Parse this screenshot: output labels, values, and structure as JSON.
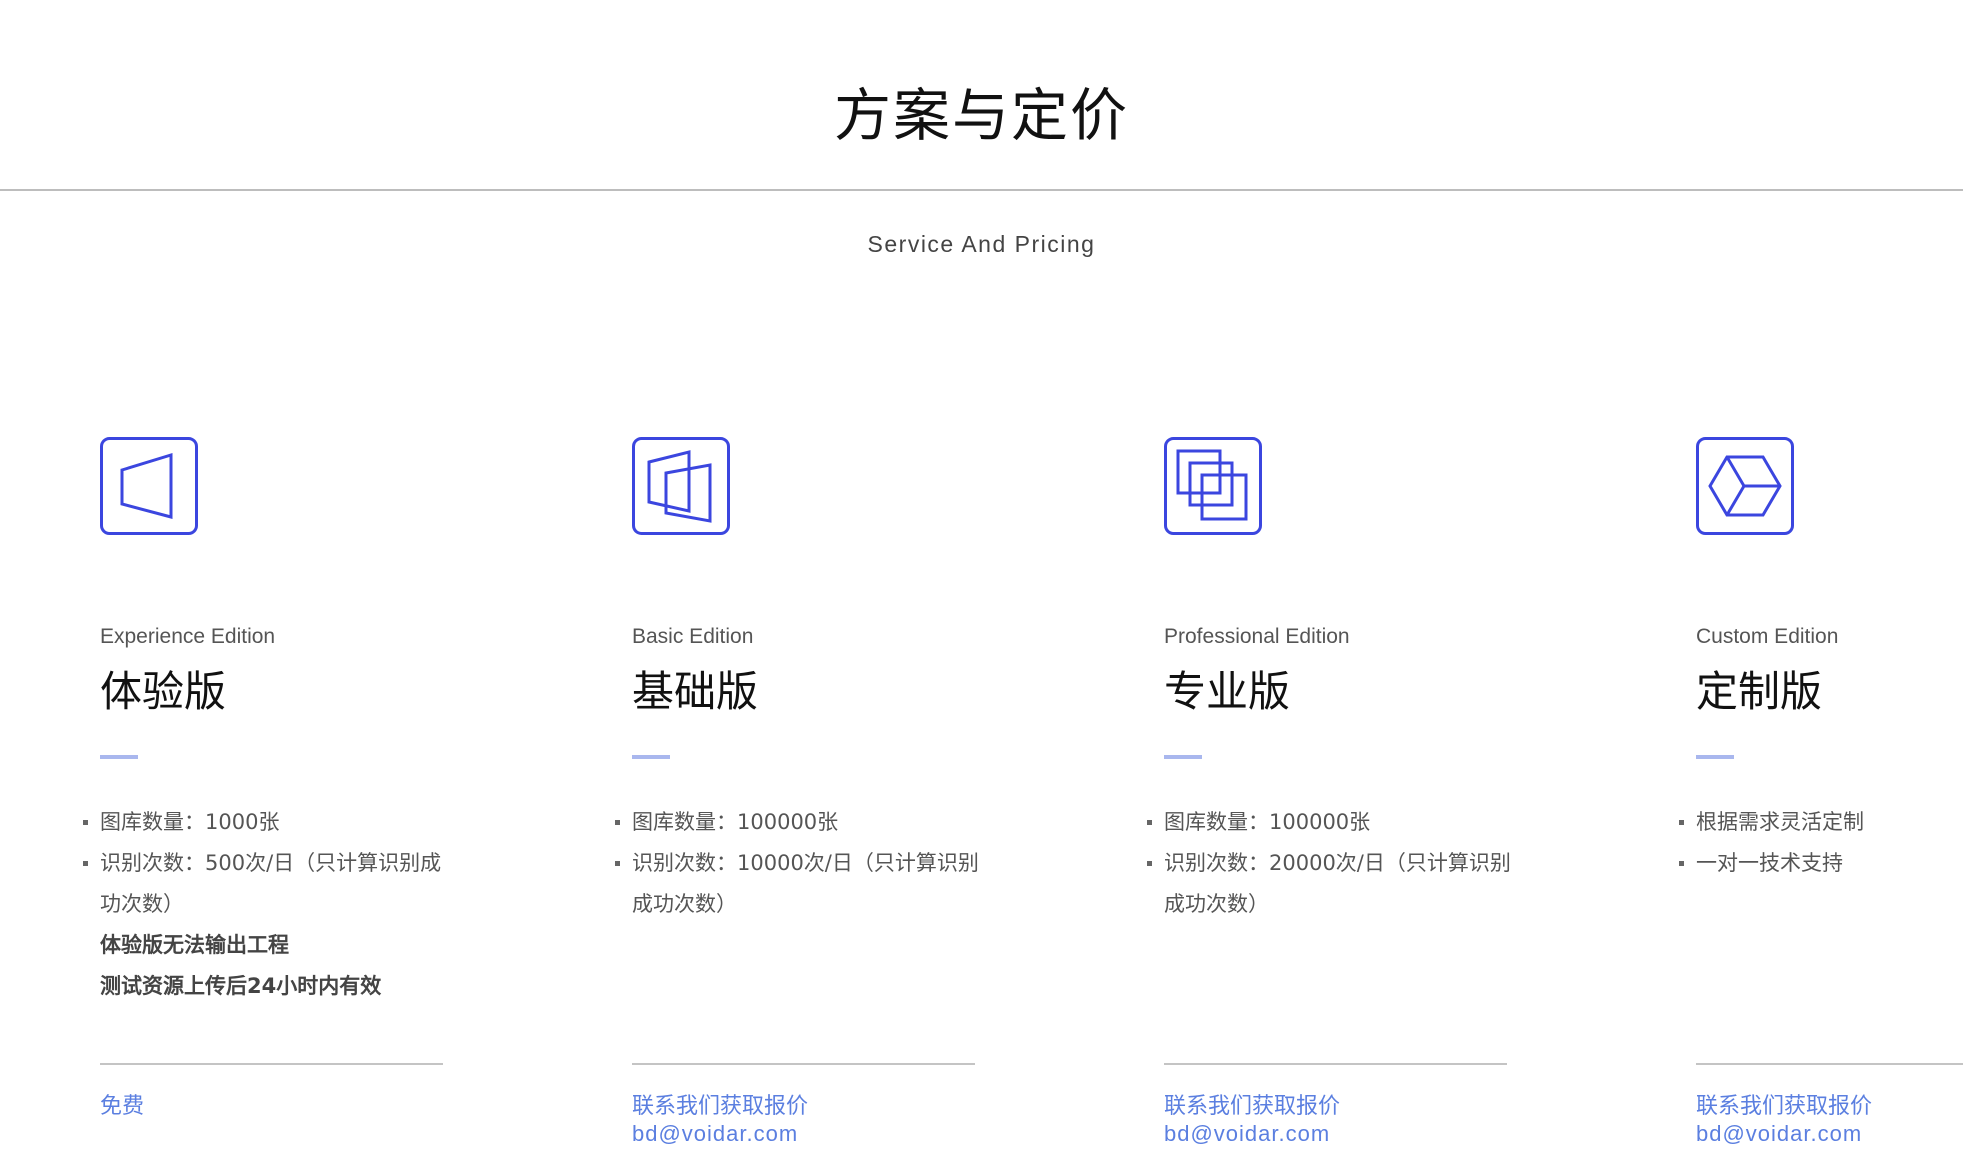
{
  "header": {
    "title": "方案与定价",
    "subtitle": "Service And Pricing"
  },
  "colors": {
    "accent": "#3b46df",
    "link": "#5b7fe0",
    "dash": "#a9b7ee"
  },
  "plans": [
    {
      "icon": "single-panel-icon",
      "edition_en": "Experience Edition",
      "edition_cn": "体验版",
      "features": [
        "图库数量：1000张",
        "识别次数：500次/日（只计算识别成功次数）"
      ],
      "notes": [
        "体验版无法输出工程",
        "测试资源上传后24小时内有效"
      ],
      "price": "免费",
      "email": ""
    },
    {
      "icon": "double-panel-icon",
      "edition_en": "Basic Edition",
      "edition_cn": "基础版",
      "features": [
        "图库数量：100000张",
        "识别次数：10000次/日（只计算识别成功次数）"
      ],
      "notes": [],
      "price": "联系我们获取报价",
      "email": "bd@voidar.com"
    },
    {
      "icon": "stacked-squares-icon",
      "edition_en": "Professional Edition",
      "edition_cn": "专业版",
      "features": [
        "图库数量：100000张",
        "识别次数：20000次/日（只计算识别成功次数）"
      ],
      "notes": [],
      "price": "联系我们获取报价",
      "email": "bd@voidar.com"
    },
    {
      "icon": "cube-icon",
      "edition_en": "Custom Edition",
      "edition_cn": "定制版",
      "features": [
        "根据需求灵活定制",
        "一对一技术支持"
      ],
      "notes": [],
      "price": "联系我们获取报价",
      "email": "bd@voidar.com"
    }
  ]
}
